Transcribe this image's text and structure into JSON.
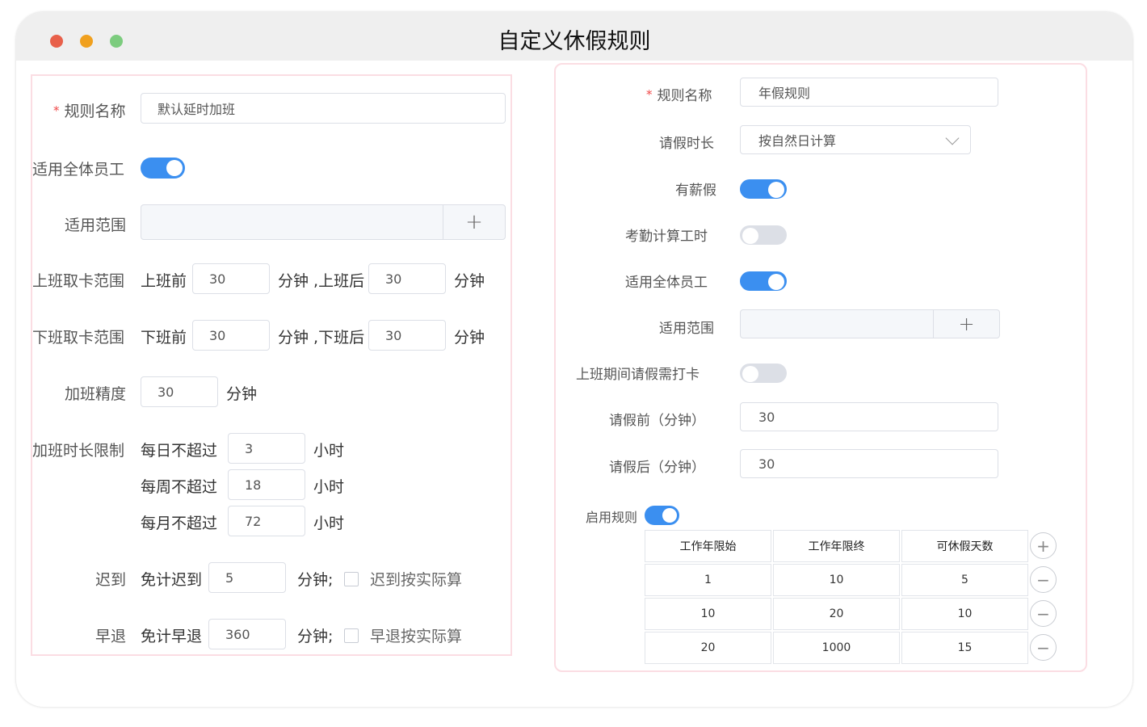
{
  "window": {
    "title": "自定义休假规则"
  },
  "left": {
    "rule_name_label": "规则名称",
    "rule_name_value": "默认延时加班",
    "apply_all_label": "适用全体员工",
    "apply_all_on": true,
    "scope_label": "适用范围",
    "scope_add": "+",
    "checkin_label": "上班取卡范围",
    "checkin_before": "上班前",
    "checkin_before_value": "30",
    "checkin_after": "分钟 ,上班后",
    "checkin_after_value": "30",
    "minute_unit": "分钟",
    "checkout_label": "下班取卡范围",
    "checkout_before": "下班前",
    "checkout_before_value": "30",
    "checkout_after": "分钟 ,下班后",
    "checkout_after_value": "30",
    "ot_precision_label": "加班精度",
    "ot_precision_value": "30",
    "ot_limit_label": "加班时长限制",
    "daily_label": "每日不超过",
    "daily_value": "3",
    "weekly_label": "每周不超过",
    "weekly_value": "18",
    "monthly_label": "每月不超过",
    "monthly_value": "72",
    "hour_unit": "小时",
    "late_label": "迟到",
    "late_free": "免计迟到",
    "late_value": "5",
    "minute_semi": "分钟;",
    "late_actual": "迟到按实际算",
    "early_label": "早退",
    "early_free": "免计早退",
    "early_value": "360",
    "early_actual": "早退按实际算"
  },
  "right": {
    "rule_name_label": "规则名称",
    "rule_name_value": "年假规则",
    "duration_label": "请假时长",
    "duration_value": "按自然日计算",
    "paid_label": "有薪假",
    "paid_on": true,
    "attendance_label": "考勤计算工时",
    "attendance_on": false,
    "apply_all_label": "适用全体员工",
    "apply_all_on": true,
    "scope_label": "适用范围",
    "scope_add": "+",
    "clockin_label": "上班期间请假需打卡",
    "clockin_on": false,
    "before_label": "请假前（分钟）",
    "before_value": "30",
    "after_label": "请假后（分钟）",
    "after_value": "30",
    "enable_label": "启用规则",
    "enable_on": true,
    "table": {
      "headers": [
        "工作年限始",
        "工作年限终",
        "可休假天数"
      ],
      "rows": [
        [
          "1",
          "10",
          "5"
        ],
        [
          "10",
          "20",
          "10"
        ],
        [
          "20",
          "1000",
          "15"
        ]
      ],
      "add_symbol": "+",
      "remove_symbol": "−"
    }
  }
}
